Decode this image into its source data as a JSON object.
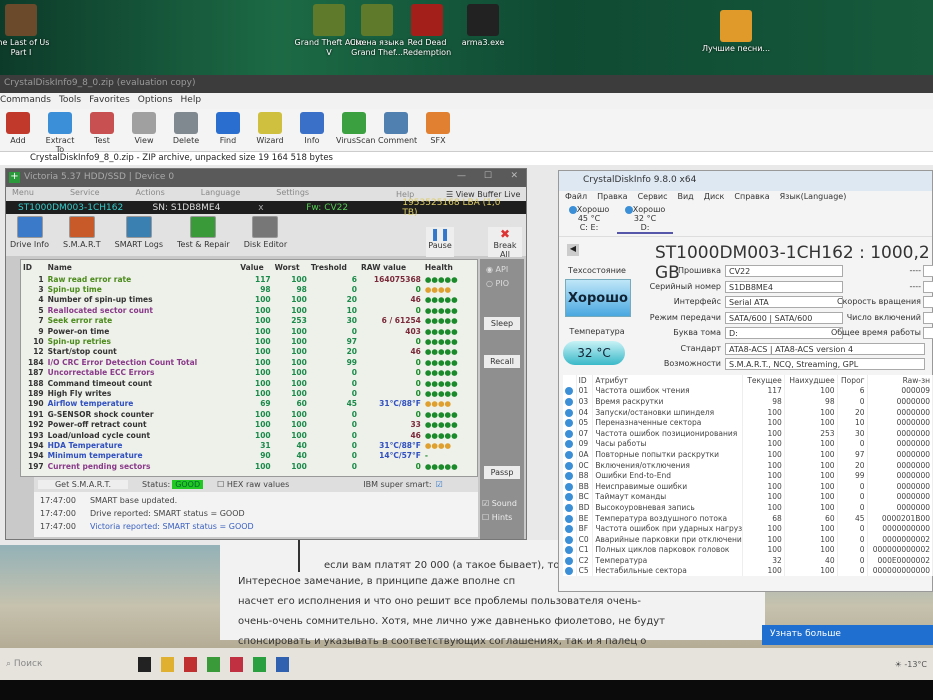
{
  "desktop": {
    "icons_top": [
      {
        "label": "The Last of Us Part I",
        "color": "#6b4a2b"
      },
      {
        "label": "Grand Theft Auto V",
        "color": "#5f7a2a"
      },
      {
        "label": "Смена языка Grand Thef...",
        "color": "#5f7a2a"
      },
      {
        "label": "Red Dead Redemption",
        "color": "#a3201a"
      },
      {
        "label": "arma3.exe",
        "color": "#222"
      },
      {
        "label": "Лучшие песни...",
        "color": "#e09a2a"
      }
    ]
  },
  "winrar": {
    "title": "CrystalDiskInfo9_8_0.zip (evaluation copy)",
    "menu": [
      "Commands",
      "Tools",
      "Favorites",
      "Options",
      "Help"
    ],
    "tools": [
      {
        "label": "Add",
        "color": "#c0392b"
      },
      {
        "label": "Extract To",
        "color": "#3a8fd8"
      },
      {
        "label": "Test",
        "color": "#c85050"
      },
      {
        "label": "View",
        "color": "#a0a0a0"
      },
      {
        "label": "Delete",
        "color": "#808890"
      },
      {
        "label": "Find",
        "color": "#2a6fd0"
      },
      {
        "label": "Wizard",
        "color": "#d0c040"
      },
      {
        "label": "Info",
        "color": "#3a70c8"
      },
      {
        "label": "VirusScan",
        "color": "#3aa040"
      },
      {
        "label": "Comment",
        "color": "#5080b0"
      },
      {
        "label": "SFX",
        "color": "#e08030"
      }
    ],
    "path": "CrystalDiskInfo9_8_0.zip - ZIP archive, unpacked size 19 164 518 bytes"
  },
  "victoria": {
    "title": "Victoria 5.37 HDD/SSD | Device 0",
    "menu": [
      "Menu",
      "Service",
      "Actions",
      "Language",
      "Settings"
    ],
    "help": "Help",
    "view_buffer": "View Buffer Live",
    "model": "ST1000DM003-1CH162",
    "sn": "SN: S1DB8ME4",
    "x": "x",
    "fw": "Fw: CV22",
    "lba": "1953525168 LBA (1,0 TB)",
    "tools": [
      "Drive Info",
      "S.M.A.R.T",
      "SMART Logs",
      "Test & Repair",
      "Disk Editor"
    ],
    "pause": "Pause",
    "break_all": "Break All",
    "columns": [
      "ID",
      "Name",
      "Value",
      "Worst",
      "Treshold",
      "RAW value",
      "Health"
    ],
    "rows": [
      [
        "1",
        "Raw read error rate",
        "117",
        "100",
        "6",
        "164075368",
        "●●●●●",
        "#4a8a1a"
      ],
      [
        "3",
        "Spin-up time",
        "98",
        "98",
        "0",
        "0",
        "●●●●",
        "#4a8a1a"
      ],
      [
        "4",
        "Number of spin-up times",
        "100",
        "100",
        "20",
        "46",
        "●●●●●",
        "#333"
      ],
      [
        "5",
        "Reallocated sector count",
        "100",
        "100",
        "10",
        "0",
        "●●●●●",
        "#8a3a8a"
      ],
      [
        "7",
        "Seek error rate",
        "100",
        "253",
        "30",
        "6 / 61254",
        "●●●●●",
        "#4a8a1a"
      ],
      [
        "9",
        "Power-on time",
        "100",
        "100",
        "0",
        "403",
        "●●●●●",
        "#333"
      ],
      [
        "10",
        "Spin-up retries",
        "100",
        "100",
        "97",
        "0",
        "●●●●●",
        "#4a8a1a"
      ],
      [
        "12",
        "Start/stop count",
        "100",
        "100",
        "20",
        "46",
        "●●●●●",
        "#333"
      ],
      [
        "184",
        "I/O CRC Error Detection Count Total",
        "100",
        "100",
        "99",
        "0",
        "●●●●●",
        "#8a3a8a"
      ],
      [
        "187",
        "Uncorrectable ECC Errors",
        "100",
        "100",
        "0",
        "0",
        "●●●●●",
        "#8a3a8a"
      ],
      [
        "188",
        "Command timeout count",
        "100",
        "100",
        "0",
        "0",
        "●●●●●",
        "#333"
      ],
      [
        "189",
        "High Fly writes",
        "100",
        "100",
        "0",
        "0",
        "●●●●●",
        "#333"
      ],
      [
        "190",
        "Airflow temperature",
        "69",
        "60",
        "45",
        "31°C/88°F",
        "●●●●",
        "#3050c0"
      ],
      [
        "191",
        "G-SENSOR shock counter",
        "100",
        "100",
        "0",
        "0",
        "●●●●●",
        "#333"
      ],
      [
        "192",
        "Power-off retract count",
        "100",
        "100",
        "0",
        "33",
        "●●●●●",
        "#333"
      ],
      [
        "193",
        "Load/unload cycle count",
        "100",
        "100",
        "0",
        "46",
        "●●●●●",
        "#333"
      ],
      [
        "194",
        "HDA Temperature",
        "31",
        "40",
        "0",
        "31°C/88°F",
        "●●●●",
        "#3050c0"
      ],
      [
        "194",
        "Minimum temperature",
        "90",
        "40",
        "0",
        "14°C/57°F",
        "-",
        "#3050c0"
      ],
      [
        "197",
        "Current pending sectors",
        "100",
        "100",
        "0",
        "0",
        "●●●●●",
        "#8a3a8a"
      ]
    ],
    "side": {
      "api": "API",
      "pio": "PIO",
      "sleep": "Sleep",
      "recall": "Recall",
      "passp": "Passp",
      "sound": "Sound",
      "hints": "Hints"
    },
    "get_smart": "Get S.M.A.R.T.",
    "status_label": "Status:",
    "status_value": "GOOD",
    "hex_raw": "HEX raw values",
    "ibm": "IBM super smart:",
    "log": [
      [
        "17:47:00",
        "SMART base updated."
      ],
      [
        "17:47:00",
        "Drive reported: SMART status = GOOD"
      ],
      [
        "17:47:00",
        "Victoria reported: SMART status = GOOD"
      ]
    ]
  },
  "cdi": {
    "title": "CrystalDiskInfo 9.8.0 x64",
    "menu": [
      "Файл",
      "Правка",
      "Сервис",
      "Вид",
      "Диск",
      "Справка",
      "Язык(Language)"
    ],
    "drives": [
      {
        "status": "Хорошо",
        "temp": "45 °C",
        "letters": "C: E:"
      },
      {
        "status": "Хорошо",
        "temp": "32 °C",
        "letters": "D:"
      }
    ],
    "model": "ST1000DM003-1CH162 : 1000,2 GB",
    "health_label": "Техсостояние",
    "health": "Хорошо",
    "temp_label": "Температура",
    "temp": "32 °C",
    "fields": [
      [
        "Прошивка",
        "CV22"
      ],
      [
        "Серийный номер",
        "S1DB8ME4"
      ],
      [
        "Интерфейс",
        "Serial ATA"
      ],
      [
        "Режим передачи",
        "SATA/600 | SATA/600"
      ],
      [
        "Буква тома",
        "D:"
      ],
      [
        "Стандарт",
        "ATA8-ACS | ATA8-ACS version 4"
      ],
      [
        "Возможности",
        "S.M.A.R.T., NCQ, Streaming, GPL"
      ]
    ],
    "right_labels": [
      "----",
      "----",
      "Скорость вращения",
      "Число включений",
      "Общее время работы"
    ],
    "columns": [
      "ID",
      "Атрибут",
      "Текущее",
      "Наихудшее",
      "Порог",
      "Raw-зн"
    ],
    "rows": [
      [
        "01",
        "Частота ошибок чтения",
        "117",
        "100",
        "6",
        "000009"
      ],
      [
        "03",
        "Время раскрутки",
        "98",
        "98",
        "0",
        "0000000"
      ],
      [
        "04",
        "Запуски/остановки шпинделя",
        "100",
        "100",
        "20",
        "0000000"
      ],
      [
        "05",
        "Переназначенные сектора",
        "100",
        "100",
        "10",
        "0000000"
      ],
      [
        "07",
        "Частота ошибок позиционирования",
        "100",
        "253",
        "30",
        "0000000"
      ],
      [
        "09",
        "Часы работы",
        "100",
        "100",
        "0",
        "0000000"
      ],
      [
        "0A",
        "Повторные попытки раскрутки",
        "100",
        "100",
        "97",
        "0000000"
      ],
      [
        "0C",
        "Включения/отключения",
        "100",
        "100",
        "20",
        "0000000"
      ],
      [
        "B8",
        "Ошибки End-to-End",
        "100",
        "100",
        "99",
        "0000000"
      ],
      [
        "BB",
        "Неисправимые ошибки",
        "100",
        "100",
        "0",
        "0000000"
      ],
      [
        "BC",
        "Таймаут команды",
        "100",
        "100",
        "0",
        "0000000"
      ],
      [
        "BD",
        "Высокоуровневая запись",
        "100",
        "100",
        "0",
        "0000000"
      ],
      [
        "BE",
        "Температура воздушного потока",
        "68",
        "60",
        "45",
        "0000201B00"
      ],
      [
        "BF",
        "Частота ошибок при ударных нагрузках",
        "100",
        "100",
        "0",
        "0000000000"
      ],
      [
        "C0",
        "Аварийные парковки при отключении пи...",
        "100",
        "100",
        "0",
        "0000000002"
      ],
      [
        "C1",
        "Полных циклов парковок головок",
        "100",
        "100",
        "0",
        "000000000002"
      ],
      [
        "C2",
        "Температура",
        "32",
        "40",
        "0",
        "000E0000002"
      ],
      [
        "C5",
        "Нестабильные сектора",
        "100",
        "100",
        "0",
        "000000000000"
      ]
    ]
  },
  "article": {
    "quote": "если вам платят 20 000 (а такое бывает), то луч",
    "lines": [
      "Интересное замечание, в принципе даже вполне сп",
      "насчет его исполнения и что оно решит все проблемы пользователя очень-",
      "очень-очень сомнительно. Хотя, мне лично уже давненько фиолетово, не будут",
      "спонсировать и указывать в соответствующих соглашениях, так и я палец о"
    ]
  },
  "learn_more": "Узнать больше",
  "taskbar": {
    "search": "Поиск",
    "weather": "-13°C",
    "apps": [
      "#222",
      "#e0b030",
      "#c03030",
      "#3a9a3a",
      "#c03040",
      "#2aa040",
      "#3060b0"
    ]
  },
  "colors": {
    "good": "#21c821",
    "cdi_good": "#4aa8e0"
  }
}
